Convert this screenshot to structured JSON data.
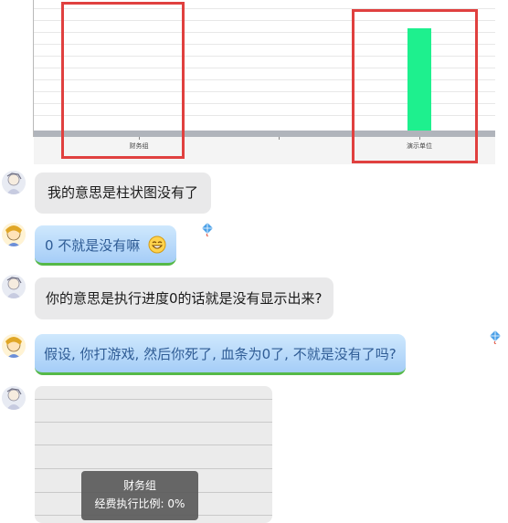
{
  "chart_data": [
    {
      "type": "bar",
      "categories": [
        "财务组",
        "演示单位"
      ],
      "values": [
        0,
        100
      ],
      "colors": {
        "bar": "#1ef08e",
        "highlight_box": "#e0403f"
      }
    },
    {
      "type": "bar",
      "tooltip": {
        "category": "财务组",
        "label": "经费执行比例:",
        "value": "0%"
      }
    }
  ],
  "chat": {
    "messages": [
      {
        "sender": "other",
        "style": "grey",
        "text": "我的意思是柱状图没有了"
      },
      {
        "sender": "self",
        "style": "blue",
        "text": "0 不就是没有嘛",
        "emoji": "grin-emoji"
      },
      {
        "sender": "other",
        "style": "grey",
        "text": "你的意思是执行进度0的话就是没有显示出来?"
      },
      {
        "sender": "self",
        "style": "blue",
        "text": "假设, 你打游戏, 然后你死了, 血条为0了, 不就是没有了吗?"
      }
    ]
  },
  "colors": {
    "grey_bubble": "#e9e9ea",
    "blue_bubble_top": "#cfe8fd",
    "blue_bubble_bottom": "#a5cdf7",
    "blue_text": "#2f5c95",
    "green_underline": "#56b948"
  }
}
